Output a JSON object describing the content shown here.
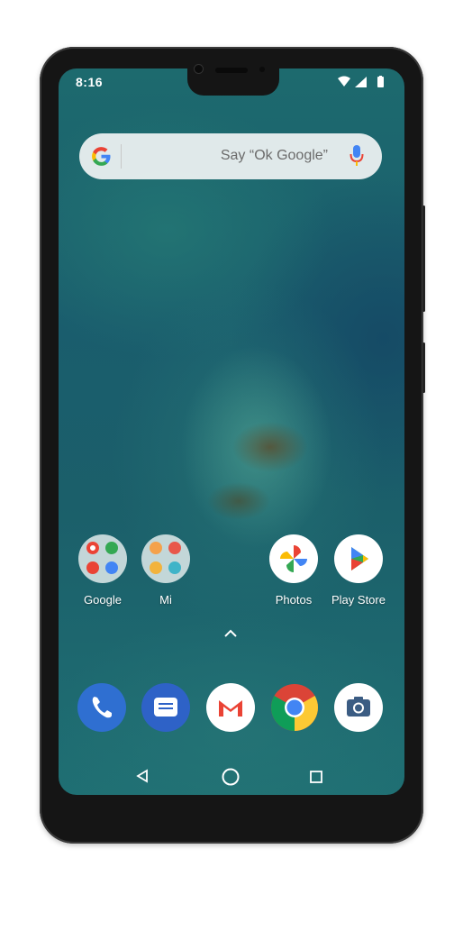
{
  "status_bar": {
    "time": "8:16"
  },
  "search": {
    "hint": "Say “Ok Google”"
  },
  "home_apps": [
    {
      "label": "Google",
      "icon": "google-folder-icon"
    },
    {
      "label": "Mi",
      "icon": "mi-folder-icon"
    },
    {
      "label": "Photos",
      "icon": "photos-icon"
    },
    {
      "label": "Play Store",
      "icon": "play-store-icon"
    }
  ],
  "dock_apps": [
    {
      "icon": "phone-icon"
    },
    {
      "icon": "messages-icon"
    },
    {
      "icon": "gmail-icon"
    },
    {
      "icon": "chrome-icon"
    },
    {
      "icon": "camera-icon"
    }
  ],
  "navigation": {
    "back": "back-icon",
    "home": "home-icon",
    "recents": "recents-icon"
  },
  "colors": {
    "google_blue": "#4285F4",
    "google_red": "#EA4335",
    "google_yellow": "#FBBC05",
    "google_green": "#34A853"
  }
}
